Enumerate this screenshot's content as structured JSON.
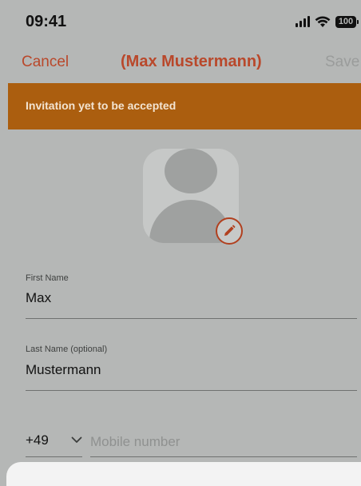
{
  "status_bar": {
    "time": "09:41",
    "battery": "100",
    "signal_icon": "signal-bars-icon",
    "wifi_icon": "wifi-icon"
  },
  "nav": {
    "cancel_label": "Cancel",
    "title": "(Max Mustermann)",
    "save_label": "Save"
  },
  "banner": {
    "text": "Invitation yet to be accepted"
  },
  "avatar": {
    "icon": "user-placeholder-icon",
    "edit_icon": "pencil-icon"
  },
  "form": {
    "first_name": {
      "label": "First Name",
      "value": "Max"
    },
    "last_name": {
      "label": "Last Name (optional)",
      "value": "Mustermann"
    },
    "phone": {
      "country_code": "+49",
      "placeholder": "Mobile number",
      "value": ""
    }
  },
  "colors": {
    "accent": "#b9482b",
    "banner": "#ab5e0f",
    "overlay_background": "#b5b7b6"
  }
}
